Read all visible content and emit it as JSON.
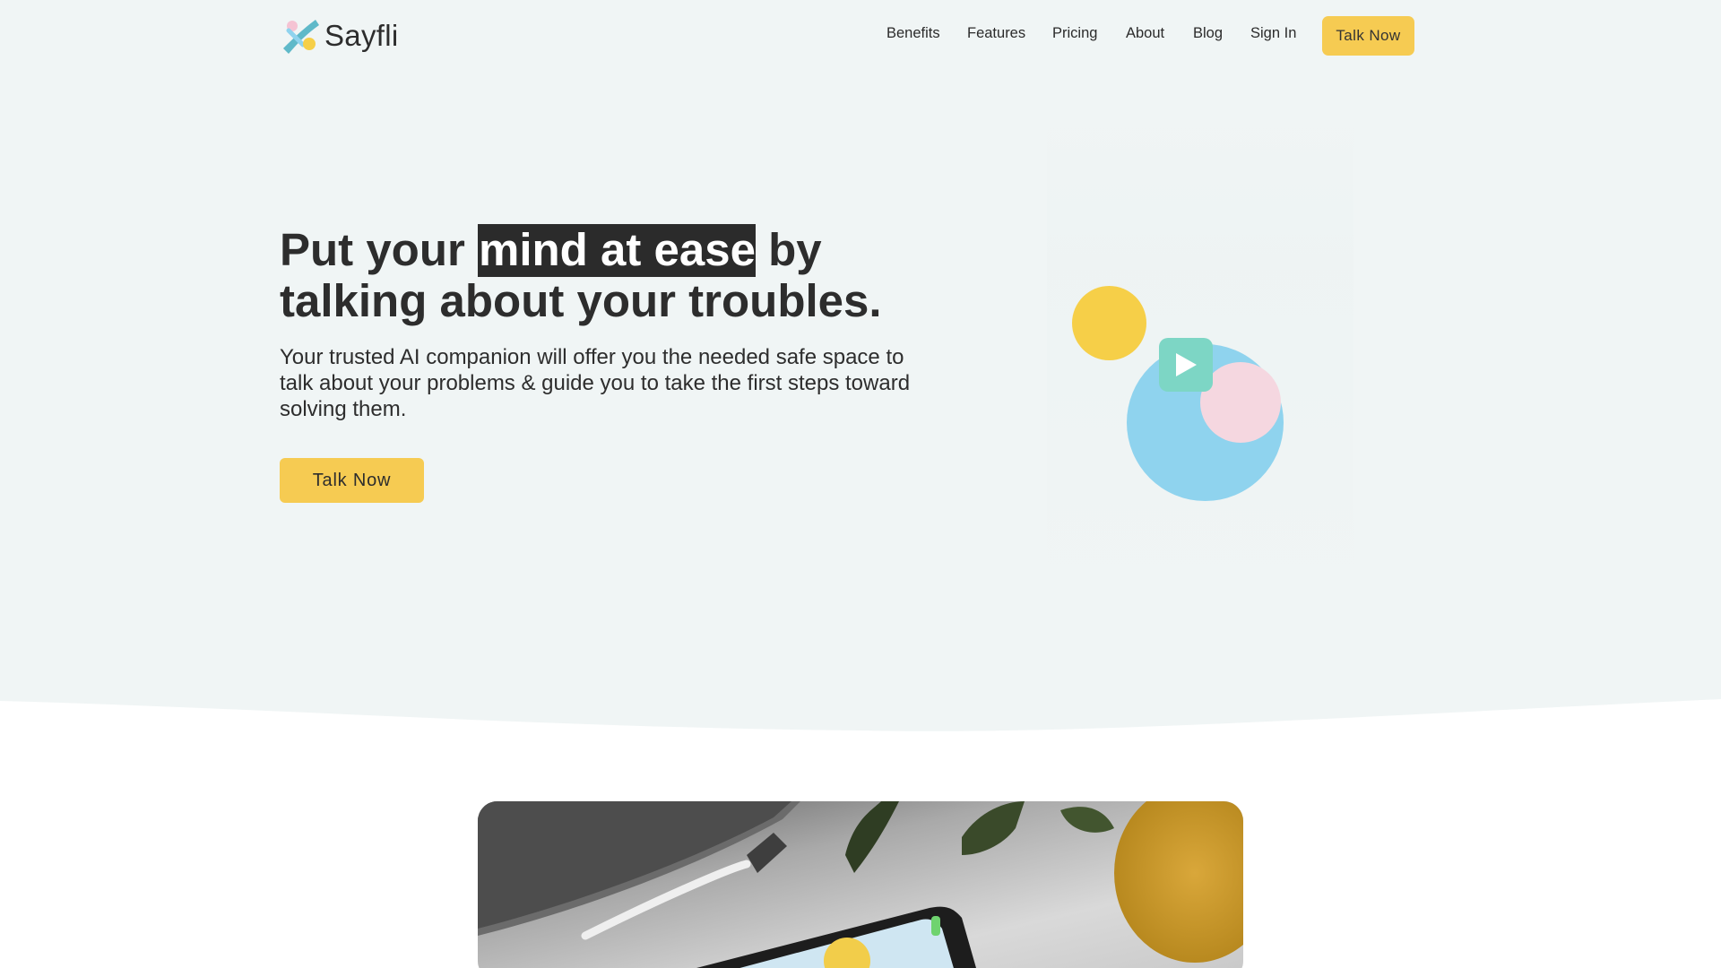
{
  "brand": {
    "name": "Sayfli"
  },
  "nav": {
    "links": [
      "Benefits",
      "Features",
      "Pricing",
      "About",
      "Blog",
      "Sign In"
    ],
    "cta_label": "Talk Now"
  },
  "hero": {
    "headline_before": "Put your ",
    "headline_highlight": "mind at ease",
    "headline_after": " by talking about your troubles.",
    "subtext": "Your trusted AI companion will offer you the needed safe space to talk about your problems & guide you to take the first steps toward solving them.",
    "cta_label": "Talk Now"
  },
  "icons": {
    "logo": "sayfli-logo-icon",
    "play": "play-icon"
  },
  "colors": {
    "hero_background": "#f0f5f5",
    "accent_yellow": "#f6cb52",
    "circle_yellow": "#f6cf48",
    "circle_blue": "#8fd3ee",
    "circle_pink": "#f5d7e0",
    "play_green": "#7dd6c5",
    "highlight_dark": "#2b2b2b"
  }
}
